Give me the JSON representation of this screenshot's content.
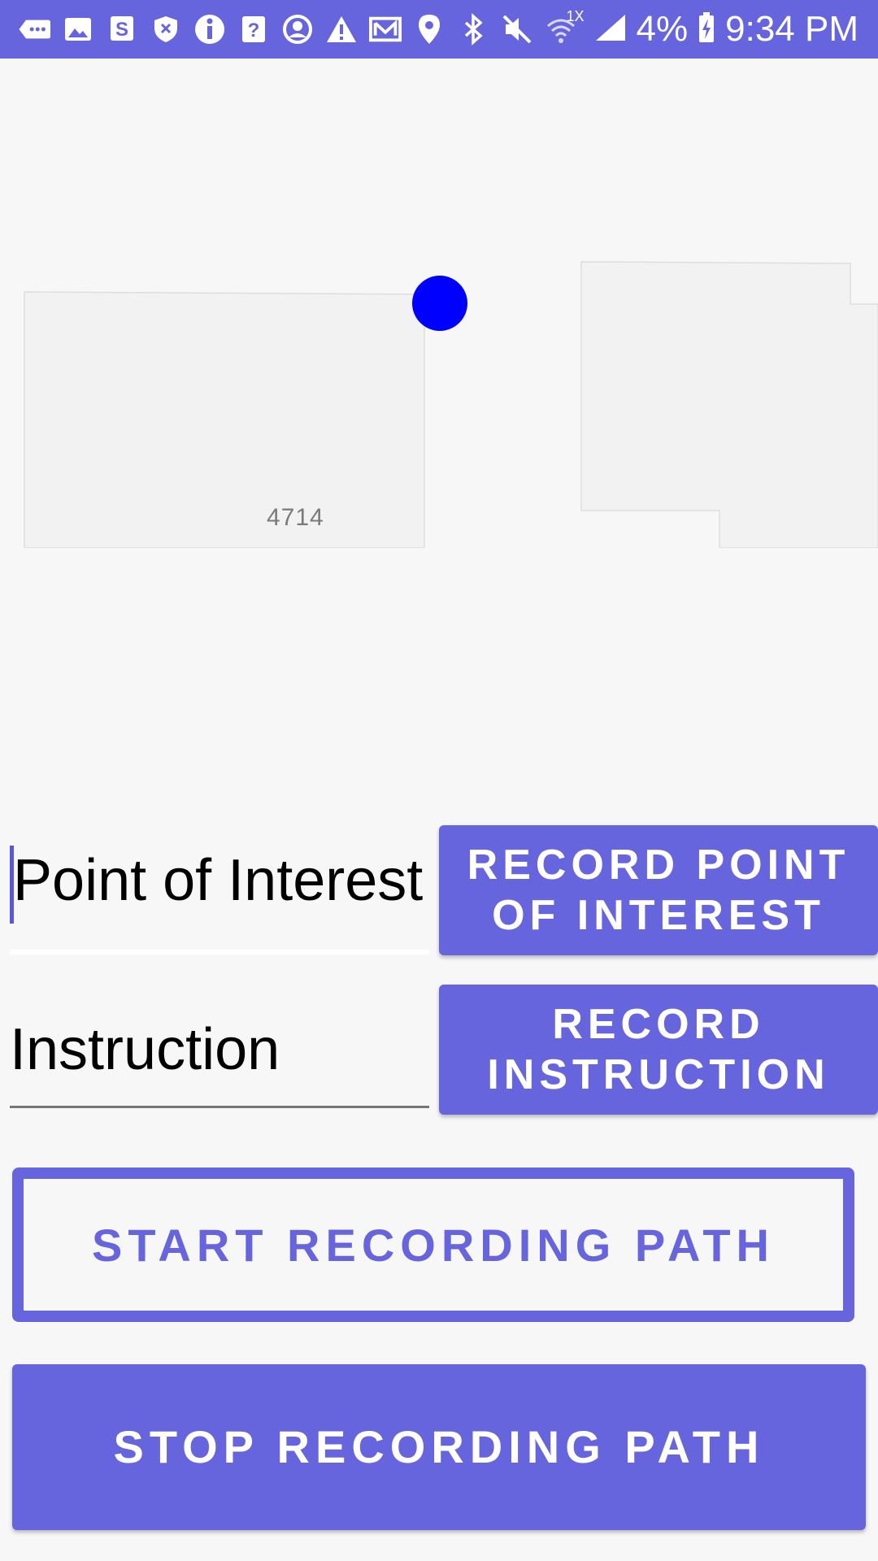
{
  "status_bar": {
    "battery_percent": "4%",
    "time": "9:34 PM",
    "speed_label": "1X",
    "icons": [
      "more-icon",
      "image-icon",
      "s-app-icon",
      "shield-icon",
      "info-icon",
      "help-icon",
      "account-icon",
      "warning-icon",
      "mail-icon",
      "location-icon",
      "bluetooth-icon",
      "mute-icon",
      "wifi-icon",
      "signal-icon",
      "battery-icon"
    ]
  },
  "map": {
    "building_label": "4714",
    "location_dot_color": "#0000ff"
  },
  "form": {
    "poi_value": "Point of Interest",
    "instruction_value": "Instruction",
    "record_poi_line1": "RECORD POINT",
    "record_poi_line2": "OF INTEREST",
    "record_instruction_line1": "RECORD",
    "record_instruction_line2": "INSTRUCTION",
    "start_label": "START RECORDING PATH",
    "stop_label": "STOP RECORDING PATH"
  },
  "colors": {
    "accent": "#6765dd",
    "background": "#f7f7f8"
  }
}
